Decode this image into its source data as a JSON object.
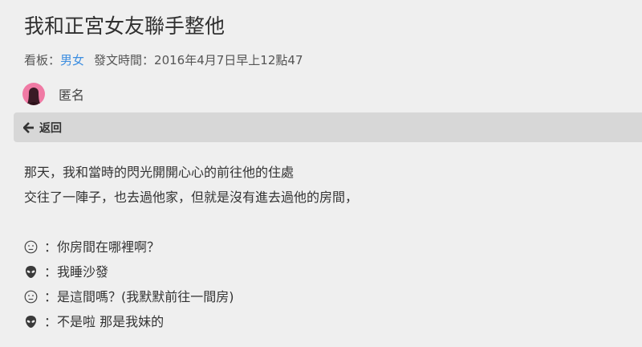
{
  "post": {
    "title": "我和正宮女友聯手整他",
    "board_label": "看板：",
    "board_name": "男女",
    "time_label": "發文時間：",
    "time_value": "2016年4月7日早上12點47"
  },
  "author": {
    "name": "匿名",
    "avatar_color": "#f07aa4"
  },
  "nav": {
    "back_label": "返回"
  },
  "content": {
    "lines": [
      "那天，我和當時的閃光開開心心的前往他的住處",
      "交往了一陣子，也去過他家，但就是沒有進去過他的房間，"
    ],
    "dialogue": [
      {
        "icon": "neutral-face-icon",
        "text": "：你房間在哪裡啊？"
      },
      {
        "icon": "alien-icon",
        "text": "：我睡沙發"
      },
      {
        "icon": "neutral-face-icon",
        "text": "：是這間嗎？(我默默前往一間房)"
      },
      {
        "icon": "alien-icon",
        "text": "：不是啦 那是我妹的"
      }
    ]
  }
}
